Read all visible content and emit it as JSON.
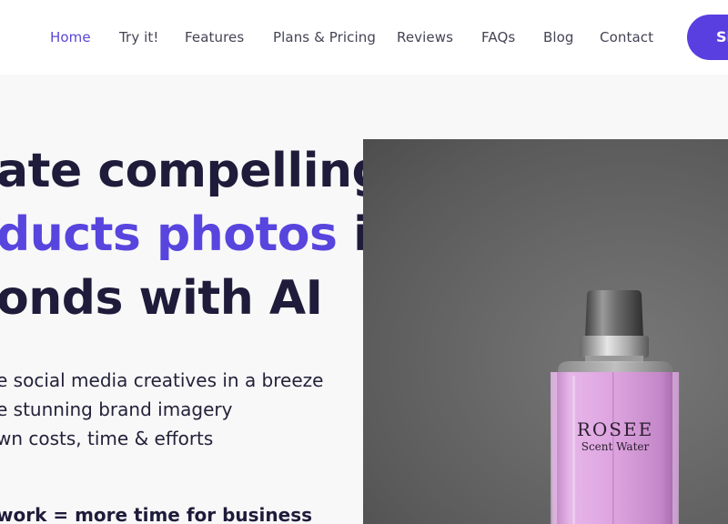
{
  "nav": {
    "links": [
      {
        "label": "Home",
        "active": true
      },
      {
        "label": "Try it!"
      },
      {
        "label": "Features"
      },
      {
        "label": "Plans & Pricing"
      },
      {
        "label": "Reviews"
      },
      {
        "label": "FAQs"
      },
      {
        "label": "Blog"
      },
      {
        "label": "Contact"
      }
    ],
    "cta_label": "Si"
  },
  "hero": {
    "line1": "ate compelling",
    "line2_accent": "ducts photos",
    "line2_rest": " in",
    "line3": "onds with AI",
    "bullets": [
      "e social media creatives in a breeze",
      "e stunning brand imagery",
      "wn costs, time & efforts"
    ],
    "tagline": "work = more time for business"
  },
  "product": {
    "brand": "ROSEE",
    "subtitle": "Scent Water"
  },
  "colors": {
    "accent": "#5a3fe0",
    "heading": "#1f1b3a",
    "liquid": "#d9a0dc"
  }
}
